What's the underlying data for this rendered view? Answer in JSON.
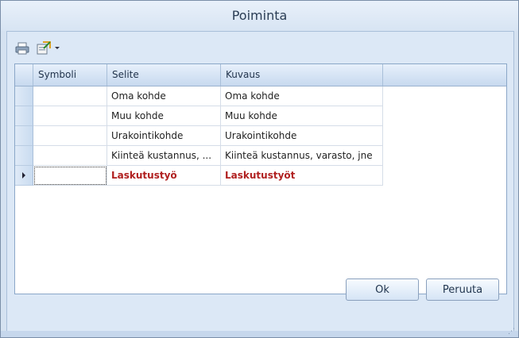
{
  "window": {
    "title": "Poiminta"
  },
  "toolbar": {
    "print_icon": "printer-icon",
    "export_icon": "export-icon",
    "dropdown_icon": "chevron-down-icon"
  },
  "grid": {
    "columns": [
      "Symboli",
      "Selite",
      "Kuvaus"
    ],
    "rows": [
      {
        "symboli": "",
        "selite": "Oma kohde",
        "kuvaus": "Oma kohde"
      },
      {
        "symboli": "",
        "selite": "Muu kohde",
        "kuvaus": "Muu kohde"
      },
      {
        "symboli": "",
        "selite": "Urakointikohde",
        "kuvaus": "Urakointikohde"
      },
      {
        "symboli": "",
        "selite": "Kiinteä kustannus, ...",
        "kuvaus": "Kiinteä kustannus, varasto, jne"
      },
      {
        "symboli": "",
        "selite": "Laskutustyö",
        "kuvaus": "Laskutustyöt"
      }
    ],
    "selected_row_index": 4,
    "highlight_color": "#b02020"
  },
  "buttons": {
    "ok": "Ok",
    "cancel": "Peruuta"
  }
}
